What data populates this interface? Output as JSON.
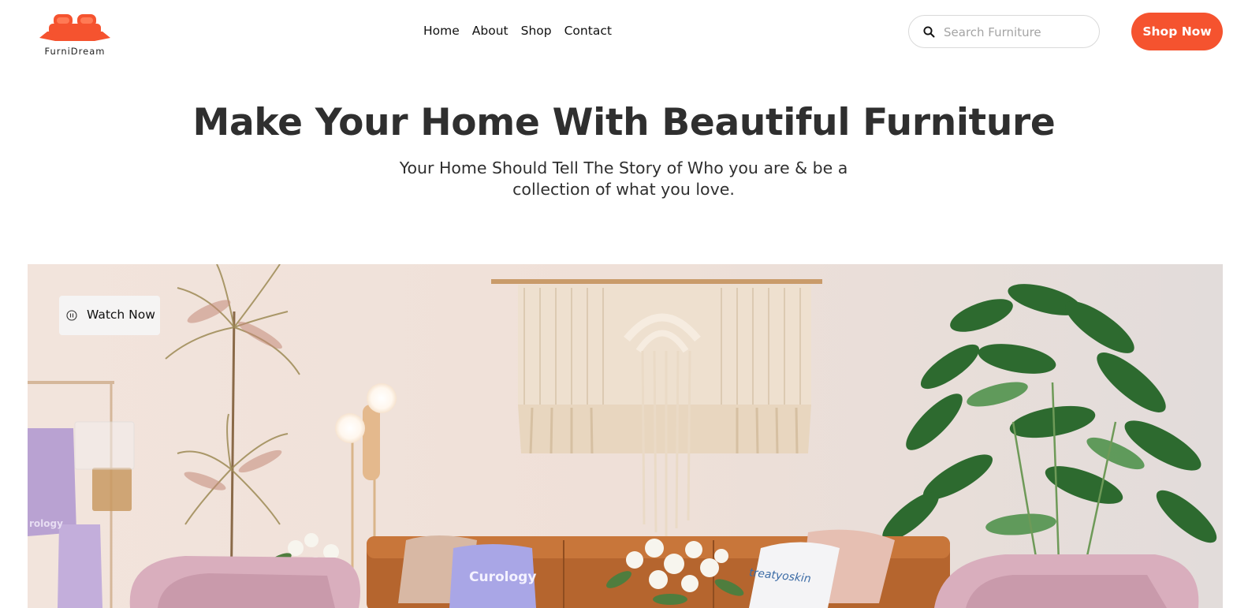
{
  "brand": {
    "name": "FurniDream",
    "accent_color": "#f5532f"
  },
  "nav": {
    "items": [
      {
        "label": "Home"
      },
      {
        "label": "About"
      },
      {
        "label": "Shop"
      },
      {
        "label": "Contact"
      }
    ]
  },
  "search": {
    "placeholder": "Search Furniture",
    "value": "",
    "icon": "search-icon"
  },
  "header_cta": {
    "label": "Shop Now"
  },
  "hero": {
    "title": "Make Your Home With Beautiful Furniture",
    "subtitle": "Your Home Should Tell The Story of Who you are & be a collection of what you love.",
    "watch_button": {
      "label": "Watch Now",
      "icon": "pause-circle-icon"
    },
    "image_texts": {
      "pillow_left": "Curology",
      "pillow_right": "treatyoskin",
      "towel": "rology"
    }
  }
}
